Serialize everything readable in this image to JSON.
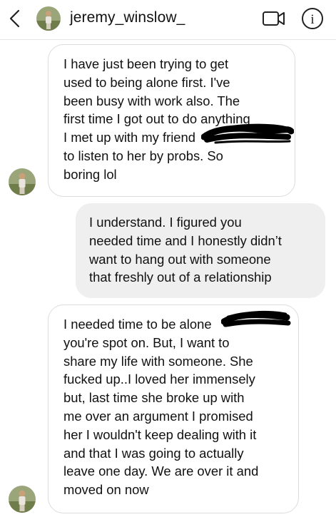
{
  "header": {
    "username": "jeremy_winslow_",
    "back_icon": "chevron-left-icon",
    "video_icon": "video-call-icon",
    "info_icon": "info-icon",
    "info_glyph": "i"
  },
  "messages": [
    {
      "sender": "them",
      "lines": [
        "I have just been trying to get",
        "used to being alone first. I've",
        "been busy with work also. The",
        "first time I got out to do anything",
        "I met up with my friend",
        "to listen to her by probs. So",
        "boring lol"
      ]
    },
    {
      "sender": "me",
      "lines": [
        "I understand. I figured you",
        "needed time and I honestly didn’t",
        "want to hang out with someone",
        "that freshly out of a relationship"
      ]
    },
    {
      "sender": "them",
      "lines": [
        "I needed time to be alone",
        "you're spot on. But, I want to",
        "share my life with someone. She",
        "fucked up..I loved her immensely",
        "but, last time she broke up with",
        "me over an argument I promised",
        "her I wouldn't keep dealing with it",
        "and that I was going to actually",
        "leave one day. We are over it and",
        "moved on now"
      ]
    }
  ],
  "colors": {
    "incoming_bubble": "#ffffff",
    "outgoing_bubble": "#efefef",
    "bubble_border": "#dcdcdc",
    "redaction": "#000000"
  }
}
